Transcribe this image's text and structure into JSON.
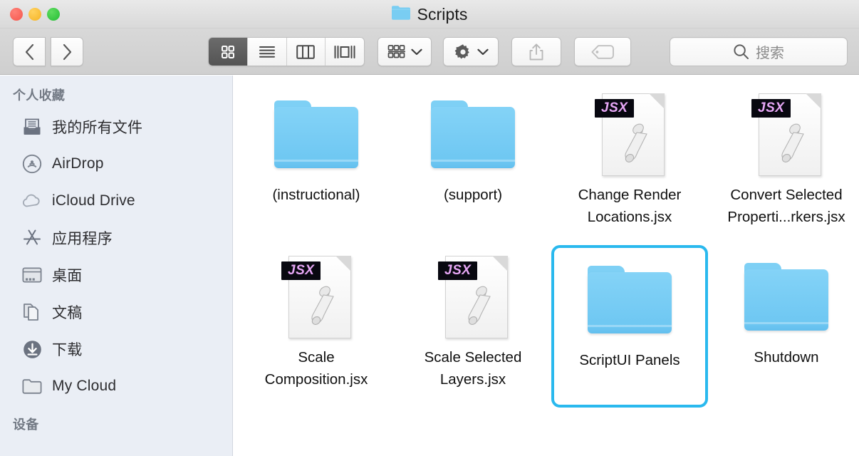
{
  "window": {
    "title": "Scripts",
    "title_icon": "folder-icon",
    "traffic_lights": [
      {
        "name": "close-button",
        "color": "#ff5f57"
      },
      {
        "name": "minimize-button",
        "color": "#febc2e"
      },
      {
        "name": "maximize-button",
        "color": "#28c840"
      }
    ]
  },
  "toolbar": {
    "back_label": "‹",
    "forward_label": "›",
    "view_modes": [
      {
        "name": "icon-view-button",
        "icon": "grid-icon",
        "active": true
      },
      {
        "name": "list-view-button",
        "icon": "list-icon",
        "active": false
      },
      {
        "name": "column-view-button",
        "icon": "columns-icon",
        "active": false
      },
      {
        "name": "coverflow-view-button",
        "icon": "coverflow-icon",
        "active": false
      }
    ],
    "arrange_button": {
      "name": "arrange-button",
      "icon": "arrange-icon"
    },
    "action_button": {
      "name": "action-button",
      "icon": "gear-icon"
    },
    "share_button": {
      "name": "share-button",
      "icon": "share-icon"
    },
    "tag_button": {
      "name": "tag-button",
      "icon": "tag-icon"
    },
    "search": {
      "placeholder": "搜索",
      "value": "",
      "icon": "search-icon"
    }
  },
  "sidebar": {
    "sections": [
      {
        "header": "个人收藏",
        "items": [
          {
            "label": "我的所有文件",
            "icon": "all-my-files-icon"
          },
          {
            "label": "AirDrop",
            "icon": "airdrop-icon"
          },
          {
            "label": "iCloud Drive",
            "icon": "icloud-icon"
          },
          {
            "label": "应用程序",
            "icon": "applications-icon"
          },
          {
            "label": "桌面",
            "icon": "desktop-icon"
          },
          {
            "label": "文稿",
            "icon": "documents-icon"
          },
          {
            "label": "下载",
            "icon": "downloads-icon"
          },
          {
            "label": "My Cloud",
            "icon": "folder-icon"
          }
        ]
      },
      {
        "header": "设备",
        "items": []
      }
    ]
  },
  "content": {
    "items": [
      {
        "name": "(instructional)",
        "type": "folder",
        "selected": false
      },
      {
        "name": "(support)",
        "type": "folder",
        "selected": false
      },
      {
        "name": "Change Render\nLocations.jsx",
        "type": "jsx",
        "selected": false,
        "badge": "JSX"
      },
      {
        "name": "Convert Selected\nProperti...rkers.jsx",
        "type": "jsx",
        "selected": false,
        "badge": "JSX"
      },
      {
        "name": "Scale\nComposition.jsx",
        "type": "jsx",
        "selected": false,
        "badge": "JSX"
      },
      {
        "name": "Scale Selected\nLayers.jsx",
        "type": "jsx",
        "selected": false,
        "badge": "JSX"
      },
      {
        "name": "ScriptUI Panels",
        "type": "folder",
        "selected": true
      },
      {
        "name": "Shutdown",
        "type": "folder",
        "selected": false
      }
    ]
  },
  "colors": {
    "selection_border": "#2ab9ee",
    "folder_blue": "#6ec7f2",
    "sidebar_bg": "#eaeef5",
    "jsx_badge_bg": "#080810",
    "jsx_badge_text": "#e6a6f5"
  }
}
